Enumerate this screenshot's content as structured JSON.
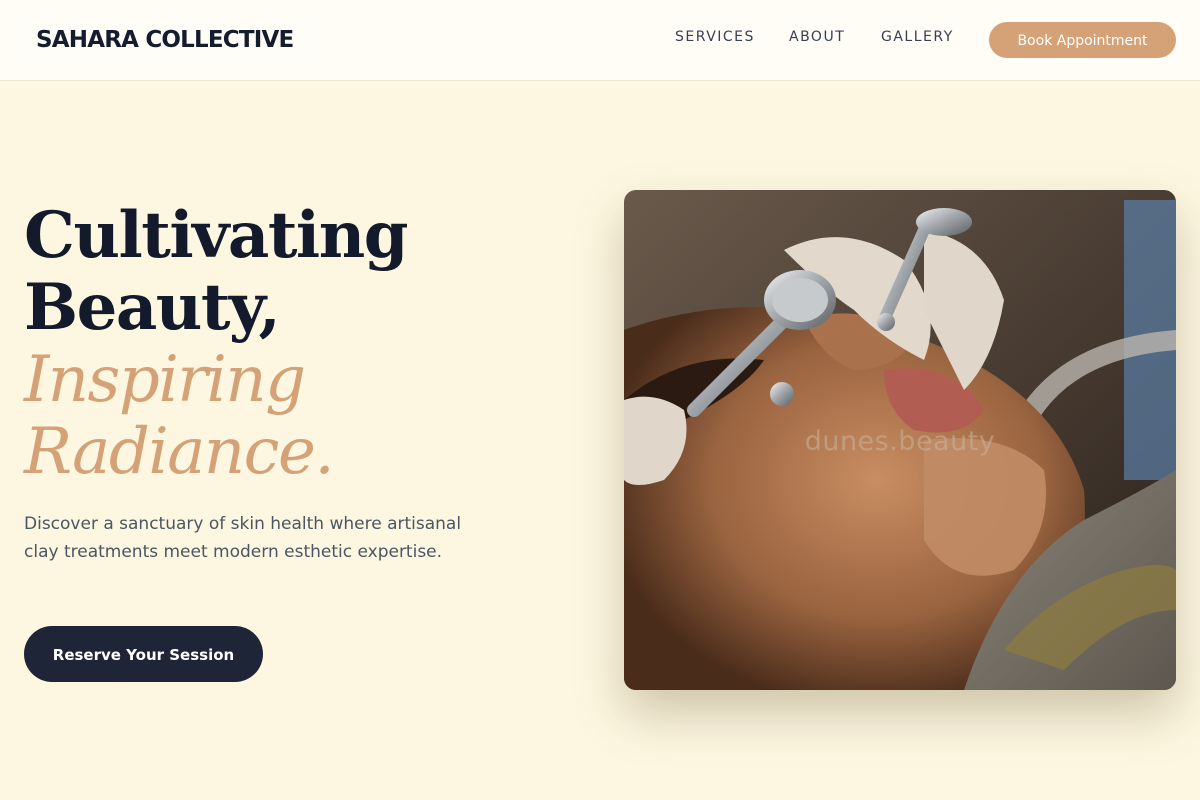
{
  "header": {
    "logo": "SAHARA COLLECTIVE",
    "nav": {
      "services": "SERVICES",
      "about": "ABOUT",
      "gallery": "GALLERY"
    },
    "cta_label": "Book Appointment"
  },
  "hero": {
    "title_line1": "Cultivating",
    "title_line2": "Beauty,",
    "accent_line1": "Inspiring",
    "accent_line2": "Radiance.",
    "description": "Discover a sanctuary of skin health where artisanal clay treatments meet modern esthetic expertise.",
    "cta_label": "Reserve Your Session"
  },
  "image": {
    "subject": "facial-treatment-photo",
    "watermark": "dunes.beauty"
  },
  "colors": {
    "background": "#fdf7e1",
    "header_bg": "#fffdf6",
    "accent": "#d4a276",
    "dark": "#1e2537",
    "title": "#121a2c"
  }
}
